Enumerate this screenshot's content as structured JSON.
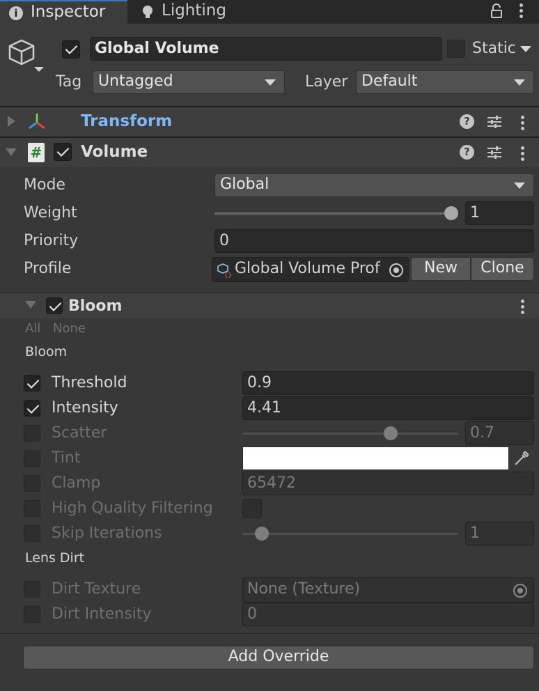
{
  "tabs": [
    {
      "label": "Inspector"
    },
    {
      "label": "Lighting"
    }
  ],
  "object": {
    "enabled": true,
    "name": "Global Volume",
    "static_label": "Static",
    "static": false,
    "tag_label": "Tag",
    "tag_value": "Untagged",
    "layer_label": "Layer",
    "layer_value": "Default"
  },
  "transform": {
    "title": "Transform"
  },
  "volume": {
    "title": "Volume",
    "enabled": true,
    "mode_label": "Mode",
    "mode_value": "Global",
    "weight_label": "Weight",
    "weight_value": "1",
    "weight_fraction": 1.0,
    "priority_label": "Priority",
    "priority_value": "0",
    "profile_label": "Profile",
    "profile_value": "Global Volume Prof",
    "new_label": "New",
    "clone_label": "Clone"
  },
  "bloom": {
    "title": "Bloom",
    "enabled": true,
    "all_label": "All",
    "none_label": "None",
    "section_bloom": "Bloom",
    "section_lens": "Lens Dirt",
    "rows": {
      "threshold": {
        "label": "Threshold",
        "value": "0.9",
        "checked": true
      },
      "intensity": {
        "label": "Intensity",
        "value": "4.41",
        "checked": true
      },
      "scatter": {
        "label": "Scatter",
        "value": "0.7",
        "checked": false,
        "fraction": 0.7
      },
      "tint": {
        "label": "Tint",
        "color": "#ffffff",
        "checked": false
      },
      "clamp": {
        "label": "Clamp",
        "value": "65472",
        "checked": false
      },
      "hq": {
        "label": "High Quality Filtering",
        "checked": false
      },
      "skip": {
        "label": "Skip Iterations",
        "value": "1",
        "checked": false
      },
      "dirt_texture": {
        "label": "Dirt Texture",
        "value": "None (Texture)",
        "checked": false
      },
      "dirt_intensity": {
        "label": "Dirt Intensity",
        "value": "0",
        "checked": false
      }
    }
  },
  "add_override_label": "Add Override",
  "colors": {
    "transform_title": "#7fb6f5",
    "background": "#383838",
    "field": "#2a2a2a"
  }
}
